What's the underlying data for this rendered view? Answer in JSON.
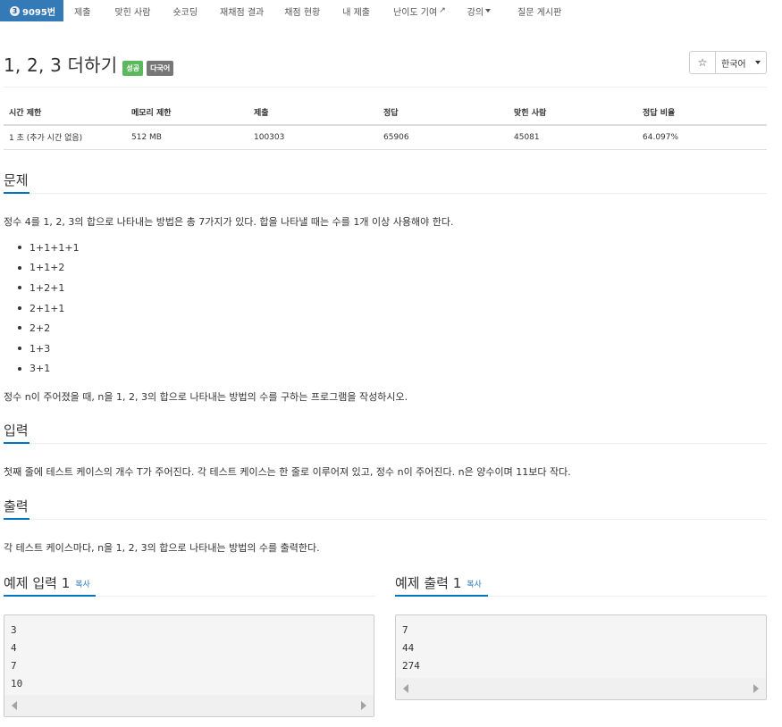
{
  "nav": {
    "active_tier": "3",
    "active_label": "9095번",
    "items": [
      "제출",
      "맞힌 사람",
      "숏코딩",
      "재채점 결과",
      "채점 현황",
      "내 제출",
      "난이도 기여",
      "강의",
      "질문 게시판"
    ],
    "external_icon": "↗",
    "colors": {
      "active_bg": "#337ab7"
    }
  },
  "problem": {
    "title": "1, 2, 3 더하기",
    "badge_success": "성공",
    "badge_lang": "다국어",
    "star_icon": "☆",
    "language_button": "한국어"
  },
  "info_table": {
    "headers": [
      "시간 제한",
      "메모리 제한",
      "제출",
      "정답",
      "맞힌 사람",
      "정답 비율"
    ],
    "row": [
      "1 초 (추가 시간 없음)",
      "512 MB",
      "100303",
      "65906",
      "45081",
      "64.097%"
    ]
  },
  "sections": {
    "problem": {
      "heading": "문제",
      "intro": "정수 4를 1, 2, 3의 합으로 나타내는 방법은 총 7가지가 있다. 합을 나타낼 때는 수를 1개 이상 사용해야 한다.",
      "list": [
        "1+1+1+1",
        "1+1+2",
        "1+2+1",
        "2+1+1",
        "2+2",
        "1+3",
        "3+1"
      ],
      "outro": "정수 n이 주어졌을 때, n을 1, 2, 3의 합으로 나타내는 방법의 수를 구하는 프로그램을 작성하시오."
    },
    "input": {
      "heading": "입력",
      "text": "첫째 줄에 테스트 케이스의 개수 T가 주어진다. 각 테스트 케이스는 한 줄로 이루어져 있고, 정수 n이 주어진다. n은 양수이며 11보다 작다."
    },
    "output": {
      "heading": "출력",
      "text": "각 테스트 케이스마다, n을 1, 2, 3의 합으로 나타내는 방법의 수를 출력한다."
    }
  },
  "samples": {
    "input": {
      "heading": "예제 입력 1",
      "copy": "복사",
      "lines": [
        "3",
        "4",
        "7",
        "10"
      ]
    },
    "output": {
      "heading": "예제 출력 1",
      "copy": "복사",
      "lines": [
        "7",
        "44",
        "274"
      ]
    }
  },
  "colors": {
    "accent": "#0076c0",
    "success": "#5cb85c",
    "default_label": "#777777",
    "link": "#337ab7"
  }
}
